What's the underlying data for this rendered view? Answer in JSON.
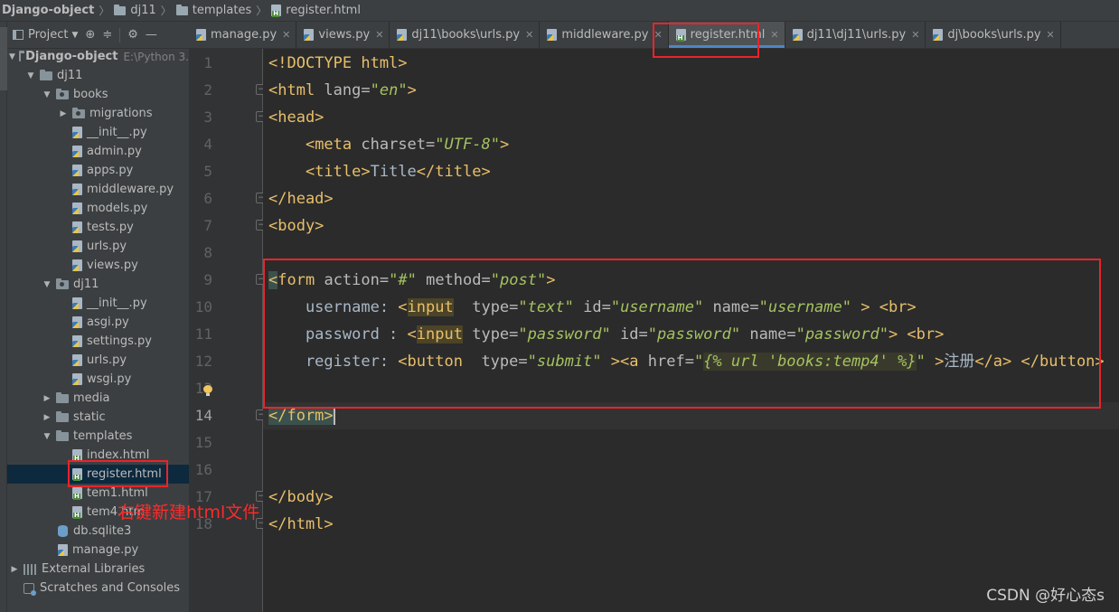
{
  "breadcrumb": {
    "project": "Django-object",
    "folder1": "dj11",
    "folder2": "templates",
    "file": "register.html"
  },
  "project_panel": {
    "title": "Project",
    "root": {
      "name": "Django-object",
      "path": "E:\\Python 3."
    },
    "items": [
      {
        "label": "dj11",
        "kind": "folder"
      },
      {
        "label": "books",
        "kind": "package"
      },
      {
        "label": "migrations",
        "kind": "package"
      },
      {
        "label": "__init__.py",
        "kind": "py"
      },
      {
        "label": "admin.py",
        "kind": "py"
      },
      {
        "label": "apps.py",
        "kind": "py"
      },
      {
        "label": "middleware.py",
        "kind": "py"
      },
      {
        "label": "models.py",
        "kind": "py"
      },
      {
        "label": "tests.py",
        "kind": "py"
      },
      {
        "label": "urls.py",
        "kind": "py"
      },
      {
        "label": "views.py",
        "kind": "py"
      },
      {
        "label": "dj11",
        "kind": "package"
      },
      {
        "label": "__init__.py",
        "kind": "py"
      },
      {
        "label": "asgi.py",
        "kind": "py"
      },
      {
        "label": "settings.py",
        "kind": "py"
      },
      {
        "label": "urls.py",
        "kind": "py"
      },
      {
        "label": "wsgi.py",
        "kind": "py"
      },
      {
        "label": "media",
        "kind": "folder"
      },
      {
        "label": "static",
        "kind": "folder"
      },
      {
        "label": "templates",
        "kind": "folder"
      },
      {
        "label": "index.html",
        "kind": "html"
      },
      {
        "label": "register.html",
        "kind": "html"
      },
      {
        "label": "tem1.html",
        "kind": "html"
      },
      {
        "label": "tem4.htm",
        "kind": "html"
      },
      {
        "label": "db.sqlite3",
        "kind": "db"
      },
      {
        "label": "manage.py",
        "kind": "py"
      },
      {
        "label": "External Libraries",
        "kind": "lib"
      },
      {
        "label": "Scratches and Consoles",
        "kind": "scratch"
      }
    ]
  },
  "tabs": [
    {
      "label": "manage.py",
      "kind": "py"
    },
    {
      "label": "views.py",
      "kind": "py"
    },
    {
      "label": "dj11\\books\\urls.py",
      "kind": "py"
    },
    {
      "label": "middleware.py",
      "kind": "py"
    },
    {
      "label": "register.html",
      "kind": "html",
      "active": true
    },
    {
      "label": "dj11\\dj11\\urls.py",
      "kind": "py"
    },
    {
      "label": "dj\\books\\urls.py",
      "kind": "py"
    }
  ],
  "editor": {
    "current_line": 14,
    "line_numbers": [
      "1",
      "2",
      "3",
      "4",
      "5",
      "6",
      "7",
      "8",
      "9",
      "10",
      "11",
      "12",
      "13",
      "14",
      "15",
      "16",
      "17",
      "18"
    ],
    "code": {
      "l1": [
        "<!DOCTYPE html>"
      ],
      "l2": [
        "<html ",
        "lang",
        "=",
        "\"en\"",
        ">"
      ],
      "l3": [
        "<head>"
      ],
      "l4": [
        "    ",
        "<meta ",
        "charset",
        "=",
        "\"UTF-8\"",
        ">"
      ],
      "l5": [
        "    ",
        "<title>",
        "Title",
        "</title>"
      ],
      "l6": [
        "</head>"
      ],
      "l7": [
        "<body>"
      ],
      "l9": [
        "<",
        "form",
        " ",
        "action",
        "=",
        "\"#\"",
        " ",
        "method",
        "=",
        "\"post\"",
        ">"
      ],
      "l10": [
        "    username: ",
        "<",
        "input",
        "  ",
        "type",
        "=",
        "\"text\"",
        " ",
        "id",
        "=",
        "\"username\"",
        " ",
        "name",
        "=",
        "\"username\"",
        " > ",
        "<br>"
      ],
      "l11": [
        "    password : ",
        "<",
        "input",
        " ",
        "type",
        "=",
        "\"password\"",
        " ",
        "id",
        "=",
        "\"password\"",
        " ",
        "name",
        "=",
        "\"password\"",
        "> ",
        "<br>"
      ],
      "l12": [
        "    register: ",
        "<button",
        "  ",
        "type",
        "=",
        "\"submit\"",
        " >",
        "<a ",
        "href",
        "=",
        "\"",
        "{% url 'books:temp4' %}",
        "\"",
        " >",
        "注册",
        "</a>",
        " ",
        "</button>"
      ],
      "l14": [
        "</form>"
      ],
      "l17": [
        "</body>"
      ],
      "l18": [
        "</html>"
      ]
    }
  },
  "annotation": "右键新建html文件",
  "watermark": "CSDN @好心态s",
  "colors": {
    "annotation_red": "#e8242b",
    "active_tab_underline": "#4a88c7"
  }
}
